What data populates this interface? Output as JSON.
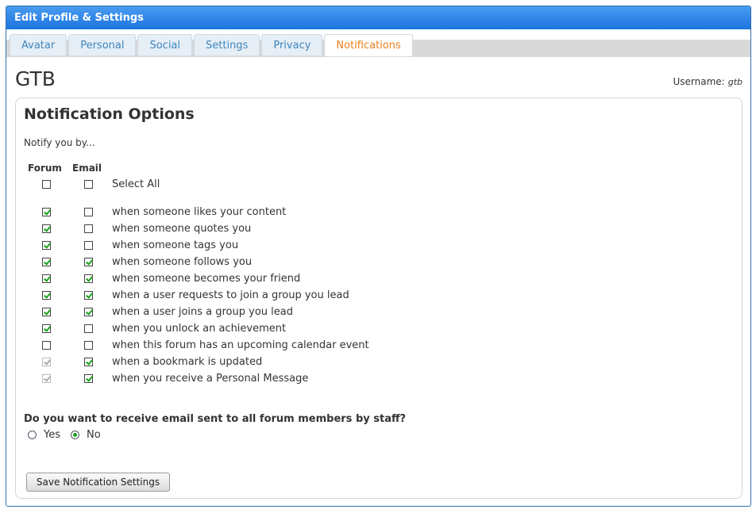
{
  "window": {
    "title": "Edit Profile & Settings"
  },
  "tabs": [
    {
      "label": "Avatar"
    },
    {
      "label": "Personal"
    },
    {
      "label": "Social"
    },
    {
      "label": "Settings"
    },
    {
      "label": "Privacy"
    },
    {
      "label": "Notifications",
      "active": true
    }
  ],
  "profile": {
    "display_name": "GTB",
    "username_label": "Username:",
    "username_value": "gtb"
  },
  "notifications": {
    "heading": "Notification Options",
    "intro": "Notify you by...",
    "col_forum": "Forum",
    "col_email": "Email",
    "select_all": {
      "label": "Select All",
      "forum": false,
      "email": false
    },
    "options": [
      {
        "label": "when someone likes your content",
        "forum": true,
        "email": false
      },
      {
        "label": "when someone quotes you",
        "forum": true,
        "email": false
      },
      {
        "label": "when someone tags you",
        "forum": true,
        "email": false
      },
      {
        "label": "when someone follows you",
        "forum": true,
        "email": true
      },
      {
        "label": "when someone becomes your friend",
        "forum": true,
        "email": true
      },
      {
        "label": "when a user requests to join a group you lead",
        "forum": true,
        "email": true
      },
      {
        "label": "when a user joins a group you lead",
        "forum": true,
        "email": true
      },
      {
        "label": "when you unlock an achievement",
        "forum": true,
        "email": false
      },
      {
        "label": "when this forum has an upcoming calendar event",
        "forum": false,
        "email": false
      },
      {
        "label": "when a bookmark is updated",
        "forum": true,
        "forum_disabled": true,
        "email": true
      },
      {
        "label": "when you receive a Personal Message",
        "forum": true,
        "forum_disabled": true,
        "email": true
      }
    ]
  },
  "staff_email": {
    "question": "Do you want to receive email sent to all forum members by staff?",
    "yes_label": "Yes",
    "no_label": "No",
    "selected": "No"
  },
  "save_button": "Save Notification Settings",
  "colors": {
    "title_bar": "#1c74df",
    "active_tab": "#e9801c",
    "tab_text": "#3d86be",
    "check": "#1aa31a"
  }
}
